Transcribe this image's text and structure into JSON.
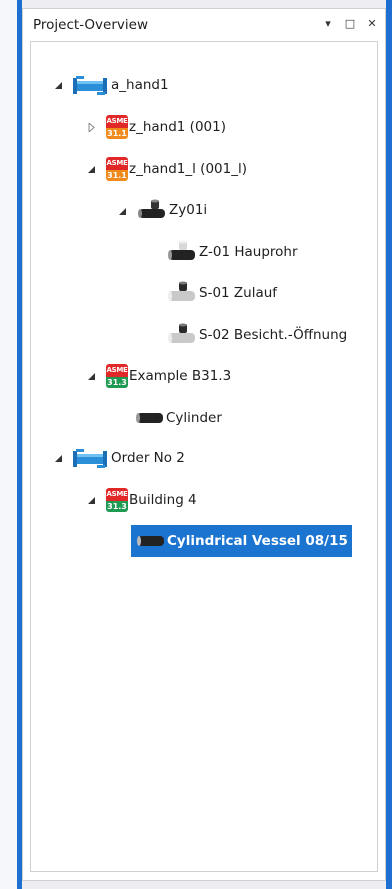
{
  "panel": {
    "title": "Project-Overview",
    "buttons": {
      "dropdown": "▾",
      "float": "□",
      "close": "✕"
    }
  },
  "tree": {
    "a_hand1": "a_hand1",
    "z_hand1": "z_hand1 (001)",
    "z_hand1_l": "z_hand1_l (001_l)",
    "zy01i": "Zy01i",
    "z01": "Z-01 Hauprohr",
    "s01": "S-01 Zulauf",
    "s02": "S-02 Besicht.-Öffnung",
    "example": "Example B31.3",
    "cylinder": "Cylinder",
    "order": "Order No 2",
    "building": "Building 4",
    "vessel": "Cylindrical Vessel 08/15"
  },
  "badges": {
    "asme": "ASME",
    "b311": "31.1",
    "b313": "31.3"
  },
  "colors": {
    "accent": "#1f6fd1",
    "selection": "#1a74d0",
    "asme_red": "#e02828",
    "b311_orange": "#f08a1c",
    "b313_green": "#1f9a52"
  },
  "icons": {
    "project": "pipe-project-icon",
    "expanded": "expanded-triangle-icon",
    "collapsed": "collapsed-triangle-icon",
    "pipe_dark": "dark-pipe-icon",
    "pipe_light": "light-pipe-icon"
  }
}
